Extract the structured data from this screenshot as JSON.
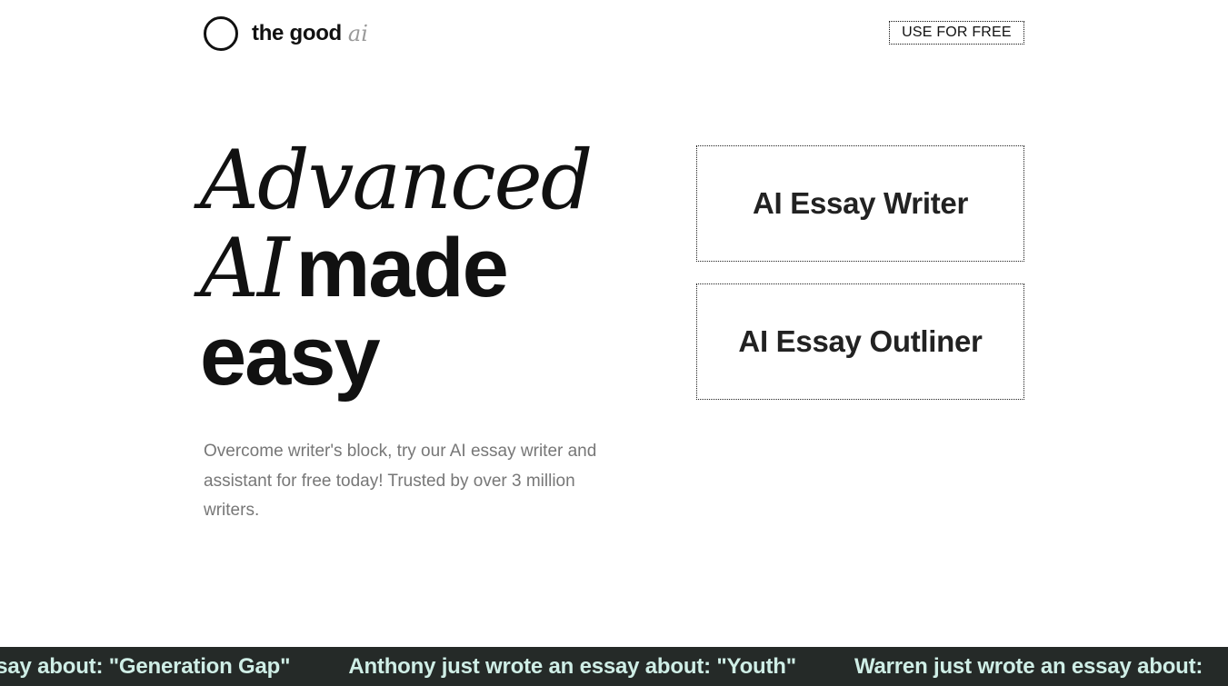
{
  "header": {
    "logo_text": "the good",
    "logo_ai": "ai",
    "cta_label": "USE FOR FREE"
  },
  "hero": {
    "line1": "Advanced",
    "line2_italic": "AI",
    "line2_bold": "made",
    "line3": "easy",
    "subtitle": "Overcome writer's block, try our AI essay writer and assistant for free today! Trusted by over 3 million writers."
  },
  "tools": [
    {
      "label": "AI Essay Writer"
    },
    {
      "label": "AI Essay Outliner"
    }
  ],
  "ticker": {
    "items": [
      "n essay about: \"Generation Gap\"",
      "Anthony just wrote an essay about: \"Youth\"",
      "Warren just wrote an essay about:"
    ]
  },
  "colors": {
    "ticker_bg": "#252a28",
    "ticker_text": "#cfeee6",
    "subtitle_text": "#777777",
    "logo_ai": "#9a9a9a"
  },
  "icons": {
    "logo": "circle-logo-icon"
  }
}
